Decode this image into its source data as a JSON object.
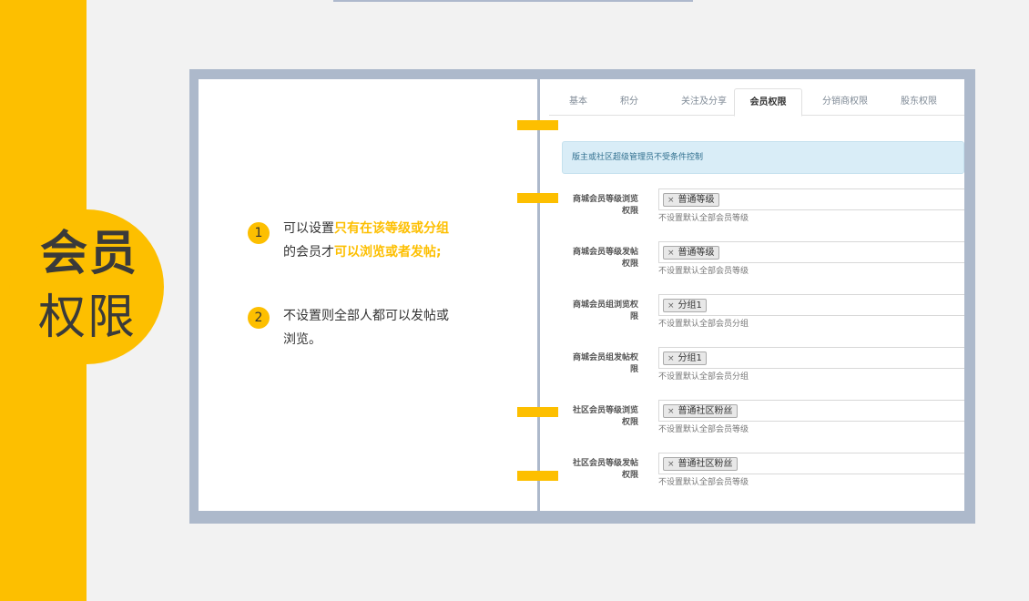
{
  "side": {
    "title_line1": "会员",
    "title_line2": "权限"
  },
  "notes": [
    {
      "number": "1",
      "line1_prefix": "可以设置",
      "line1_highlight": "只有在该等级或分组",
      "line2_prefix": "的会员才",
      "line2_highlight": "可以浏览或者发帖;"
    },
    {
      "number": "2",
      "line1": "不设置则全部人都可以发帖或",
      "line2": "浏览。"
    }
  ],
  "tabs": [
    {
      "label": "基本"
    },
    {
      "label": "积分"
    },
    {
      "label": "关注及分享"
    },
    {
      "label": "会员权限"
    },
    {
      "label": "分销商权限"
    },
    {
      "label": "股东权限"
    }
  ],
  "active_tab": "会员权限",
  "alert": "版主或社区超级管理员不受条件控制",
  "rows": [
    {
      "label_line1": "商城会员等级浏览",
      "label_line2": "权限",
      "chip": "普通等级",
      "help": "不设置默认全部会员等级"
    },
    {
      "label_line1": "商城会员等级发帖",
      "label_line2": "权限",
      "chip": "普通等级",
      "help": "不设置默认全部会员等级"
    },
    {
      "label_line1": "商城会员组浏览权",
      "label_line2": "限",
      "chip": "分组1",
      "help": "不设置默认全部会员分组"
    },
    {
      "label_line1": "商城会员组发帖权",
      "label_line2": "限",
      "chip": "分组1",
      "help": "不设置默认全部会员分组"
    },
    {
      "label_line1": "社区会员等级浏览",
      "label_line2": "权限",
      "chip": "普通社区粉丝",
      "help": "不设置默认全部会员等级"
    },
    {
      "label_line1": "社区会员等级发帖",
      "label_line2": "权限",
      "chip": "普通社区粉丝",
      "help": "不设置默认全部会员等级"
    }
  ],
  "chip_remove_symbol": "×",
  "colors": {
    "accent": "#fdbf00",
    "frame": "#adb9cb",
    "background": "#f2f2f2",
    "alert_bg": "#d9edf7",
    "alert_text": "#31708f"
  }
}
